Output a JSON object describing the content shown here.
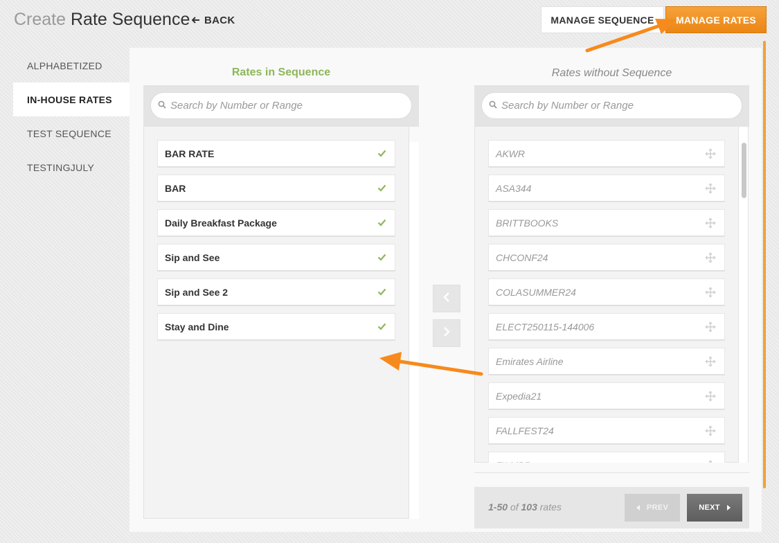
{
  "header": {
    "title_light": "Create",
    "title_main": "Rate Sequence",
    "back_label": "BACK",
    "manage_sequence_label": "MANAGE SEQUENCE",
    "manage_rates_label": "MANAGE RATES"
  },
  "sidebar": {
    "items": [
      {
        "label": "ALPHABETIZED",
        "active": false
      },
      {
        "label": "IN-HOUSE RATES",
        "active": true
      },
      {
        "label": "TEST SEQUENCE",
        "active": false
      },
      {
        "label": "TESTINGJULY",
        "active": false
      }
    ]
  },
  "left_column": {
    "title": "Rates in Sequence",
    "search_placeholder": "Search by Number or Range",
    "rates": [
      "BAR RATE",
      "BAR",
      "Daily Breakfast Package",
      "Sip and See",
      "Sip and See 2",
      "Stay and Dine"
    ]
  },
  "right_column": {
    "title": "Rates without Sequence",
    "search_placeholder": "Search by Number or Range",
    "rates": [
      "AKWR",
      "ASA344",
      "BRITTBOOKS",
      "CHCONF24",
      "COLASUMMER24",
      "ELECT250115-144006",
      "Emirates Airline",
      "Expedia21",
      "FALLFEST24",
      "FILMBB"
    ]
  },
  "pager": {
    "range": "1-50",
    "of_word": "of",
    "total": "103",
    "unit": "rates",
    "prev_label": "PREV",
    "next_label": "NEXT"
  },
  "colors": {
    "accent_orange": "#f39224",
    "check_green": "#8db65a"
  },
  "icons": {
    "back": "arrow-left-icon",
    "search": "search-icon",
    "check": "checkmark-icon",
    "move": "move-icon",
    "move_left": "chevron-left-icon",
    "move_right": "chevron-right-icon"
  }
}
